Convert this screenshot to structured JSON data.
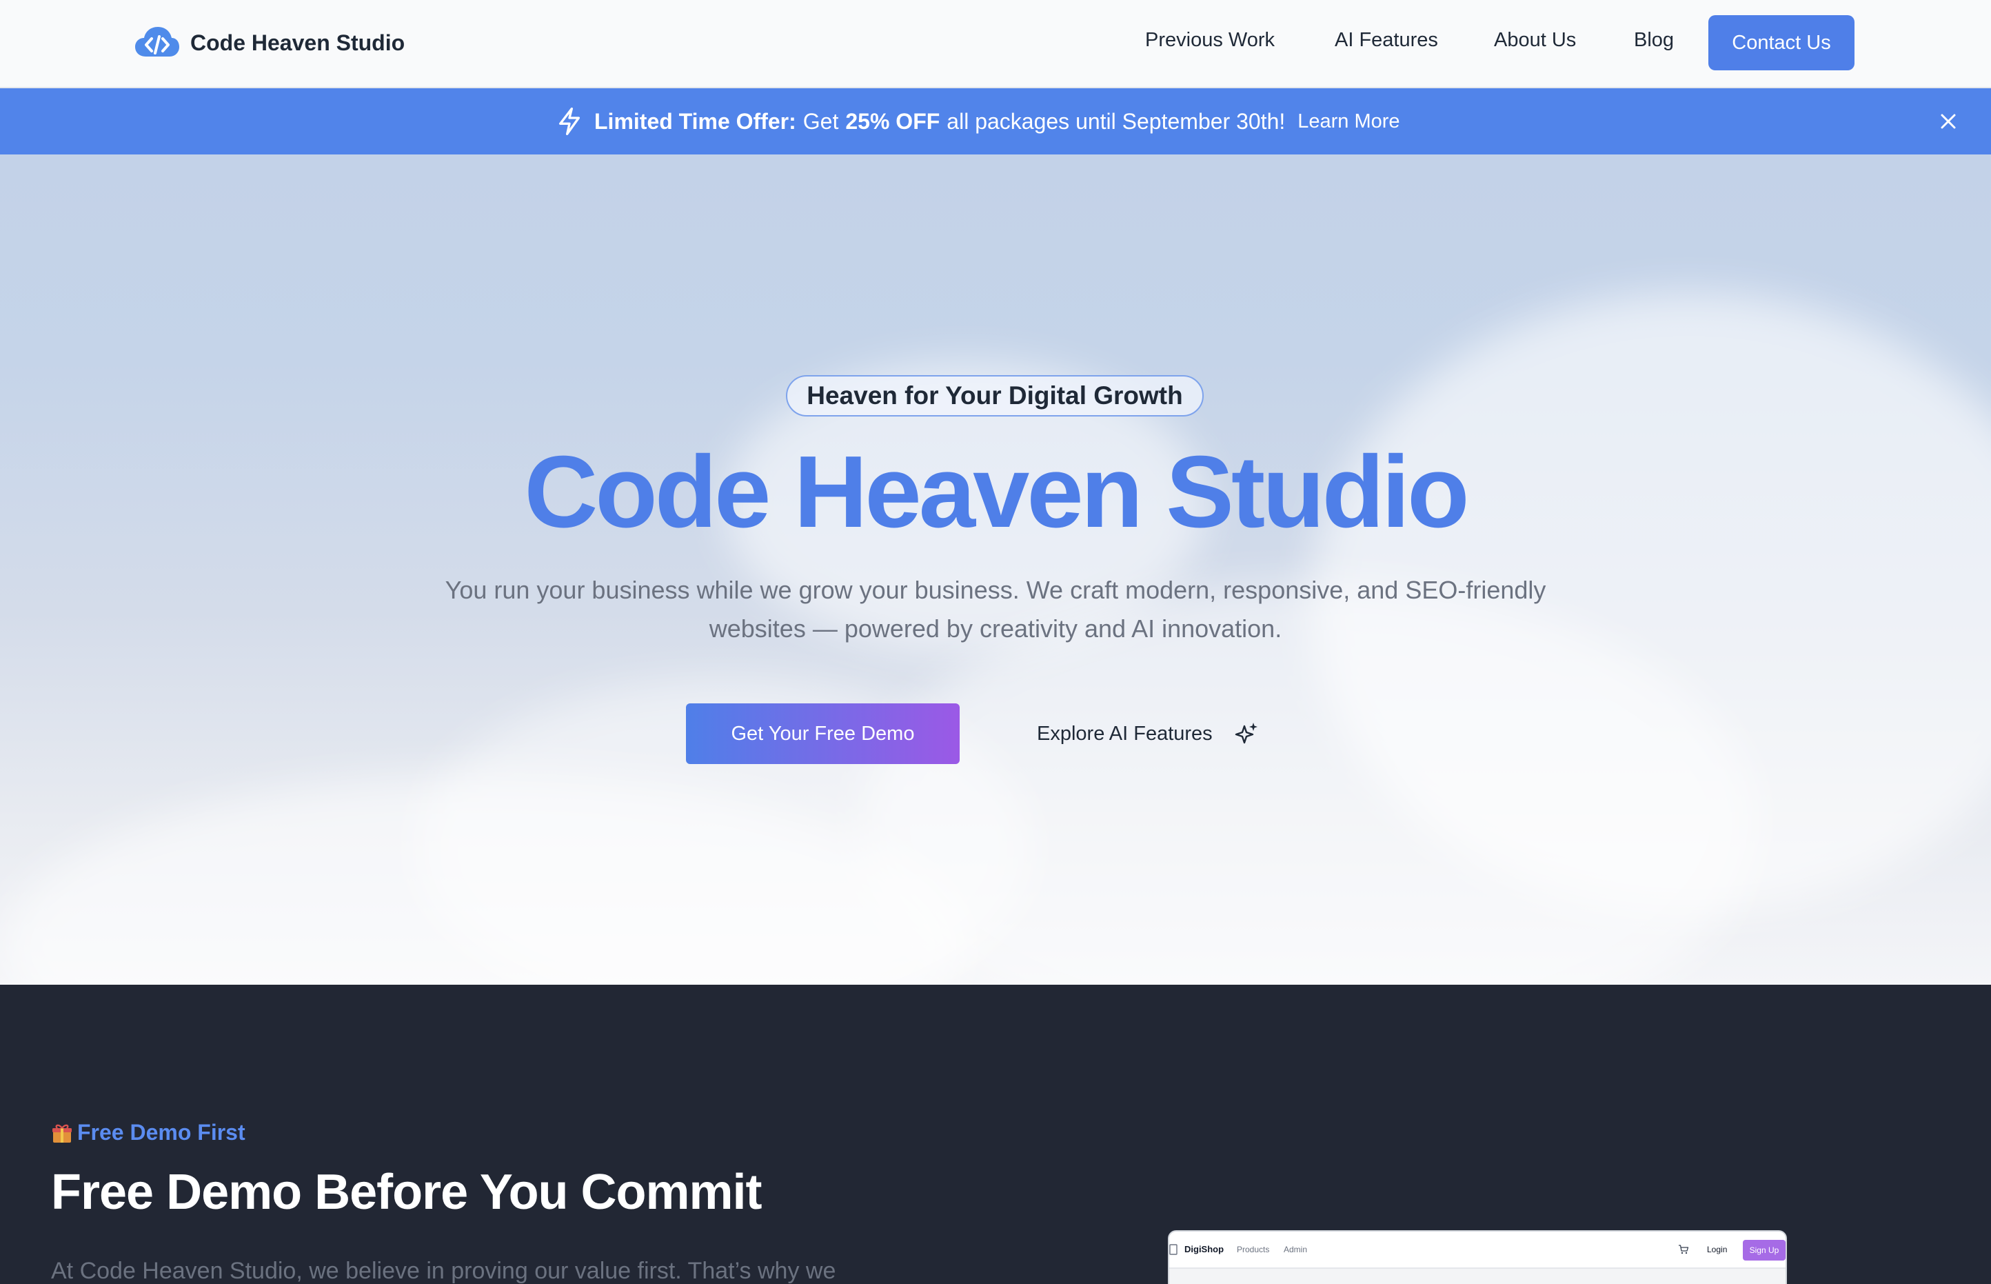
{
  "header": {
    "brand": "Code Heaven Studio",
    "nav": [
      "Previous Work",
      "AI Features",
      "About Us",
      "Blog"
    ],
    "cta": "Contact Us"
  },
  "banner": {
    "strong": "Limited Time Offer:",
    "text_pre": "Get",
    "discount": "25% OFF",
    "text_post": "all packages until September 30th!",
    "link": "Learn More"
  },
  "hero": {
    "badge": "Heaven for Your Digital Growth",
    "title": "Code Heaven Studio",
    "subtitle": "You run your business while we grow your business. We craft modern, responsive, and SEO-friendly websites — powered by creativity and AI innovation.",
    "primary_cta": "Get Your Free Demo",
    "secondary_cta": "Explore AI Features"
  },
  "demo_section": {
    "eyebrow": "Free Demo First",
    "title": "Free Demo Before You Commit",
    "paragraph": "At Code Heaven Studio, we believe in proving our value first. That’s why we",
    "preview": {
      "brand": "DigiShop",
      "links": [
        "Products",
        "Admin"
      ],
      "login": "Login",
      "signup": "Sign Up"
    }
  },
  "colors": {
    "accent": "#4f7fe8",
    "banner": "#5184ea",
    "gradient_end": "#9b59e6",
    "dark_bg": "#222734"
  },
  "icons": [
    "cloud-code-logo-icon",
    "bolt-icon",
    "close-icon",
    "sparkle-icon",
    "gift-icon",
    "cart-icon"
  ]
}
